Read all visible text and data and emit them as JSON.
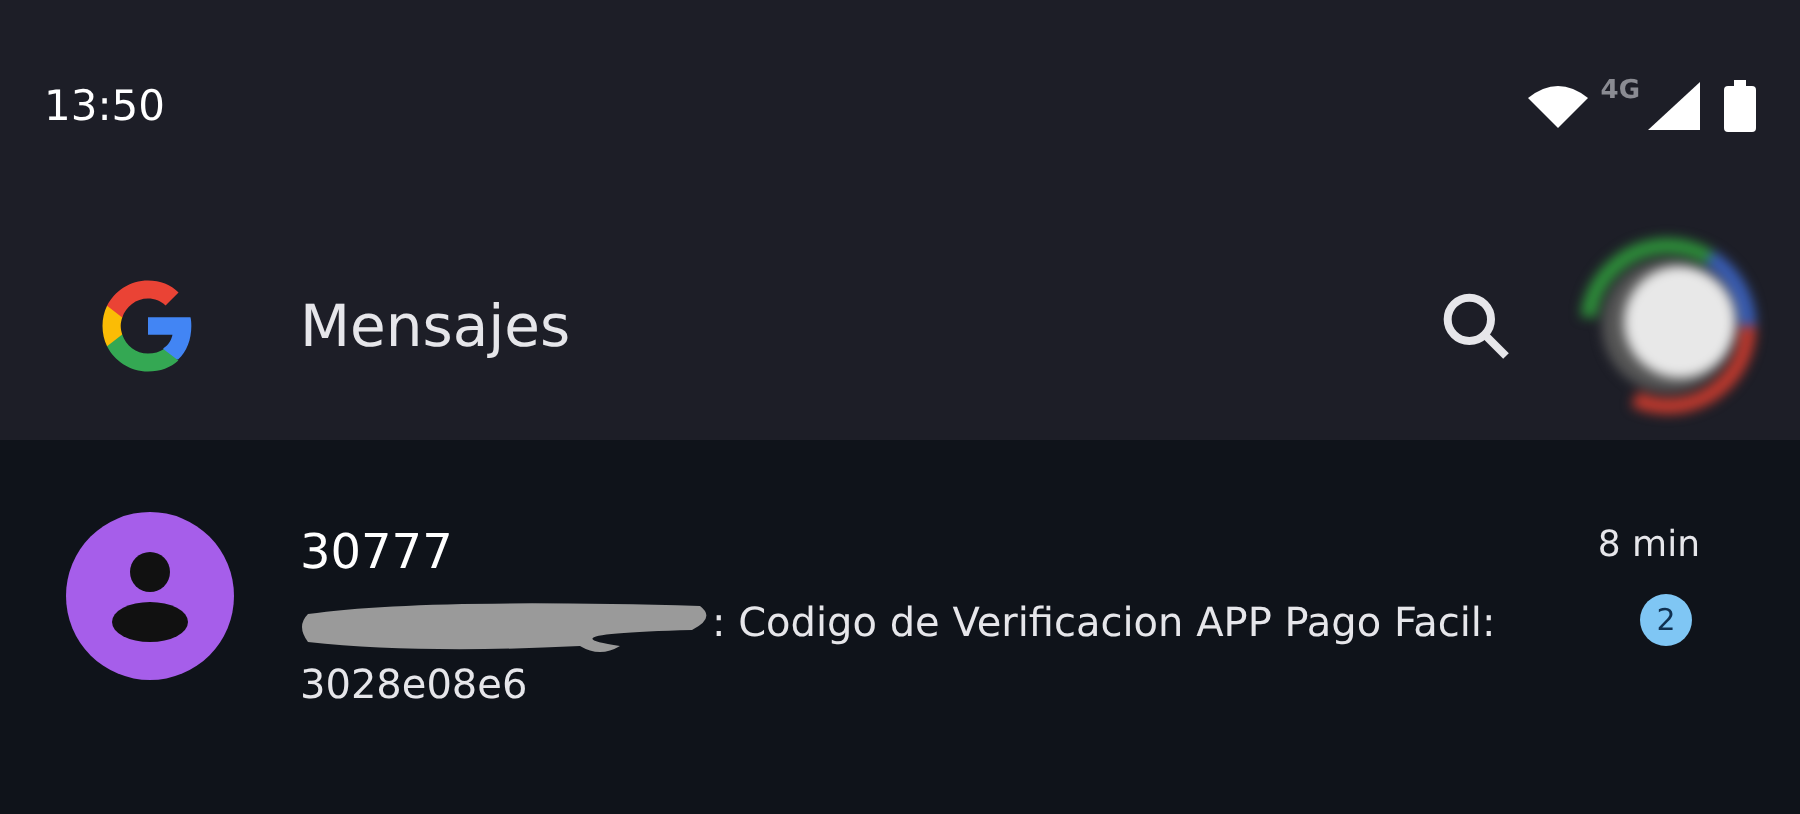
{
  "status_bar": {
    "time": "13:50",
    "network": "4G"
  },
  "app_bar": {
    "title": "Mensajes"
  },
  "conversations": [
    {
      "sender": "30777",
      "preview": ": Codigo de Verificacion APP Pago Facil: 3028e08e6",
      "redacted": true,
      "time": "8 min",
      "unread_count": "2"
    }
  ]
}
